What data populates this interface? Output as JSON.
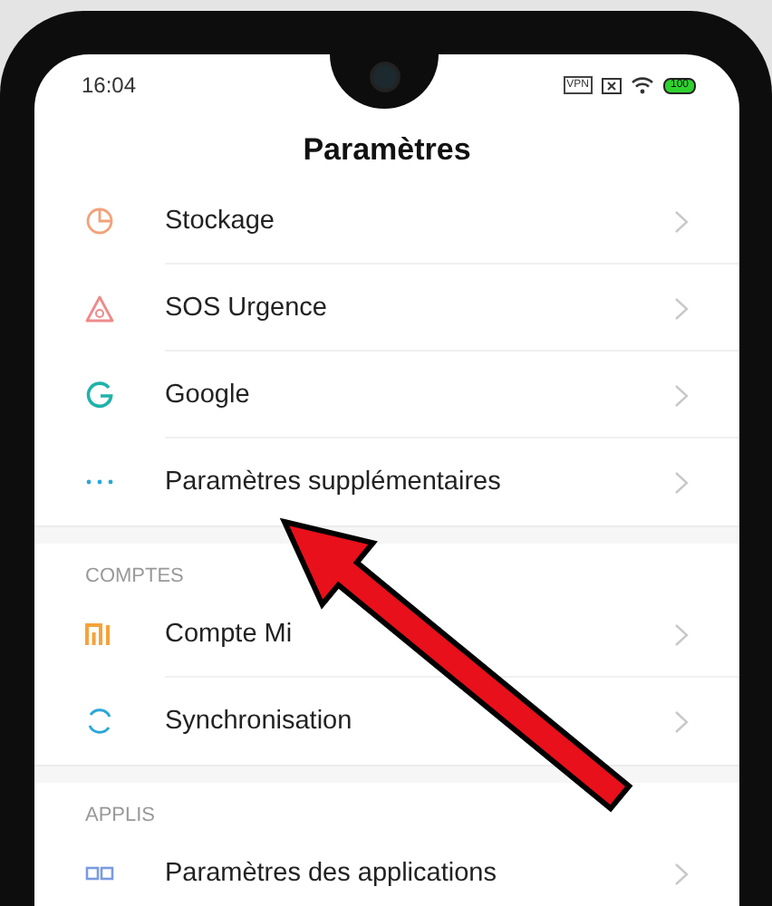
{
  "status_bar": {
    "time": "16:04",
    "vpn": "VPN",
    "battery": "100"
  },
  "title": "Paramètres",
  "sections": [
    {
      "items": [
        {
          "label": "Stockage",
          "kind": "storage"
        },
        {
          "label": "SOS Urgence",
          "kind": "sos"
        },
        {
          "label": "Google",
          "kind": "google"
        },
        {
          "label": "Paramètres supplémentaires",
          "kind": "more"
        }
      ]
    },
    {
      "header": "COMPTES",
      "items": [
        {
          "label": "Compte Mi",
          "kind": "mi"
        },
        {
          "label": "Synchronisation",
          "kind": "sync"
        }
      ]
    },
    {
      "header": "APPLIS",
      "items": [
        {
          "label": "Paramètres des applications",
          "kind": "apps"
        }
      ]
    }
  ],
  "annotation": {
    "kind": "arrow"
  }
}
